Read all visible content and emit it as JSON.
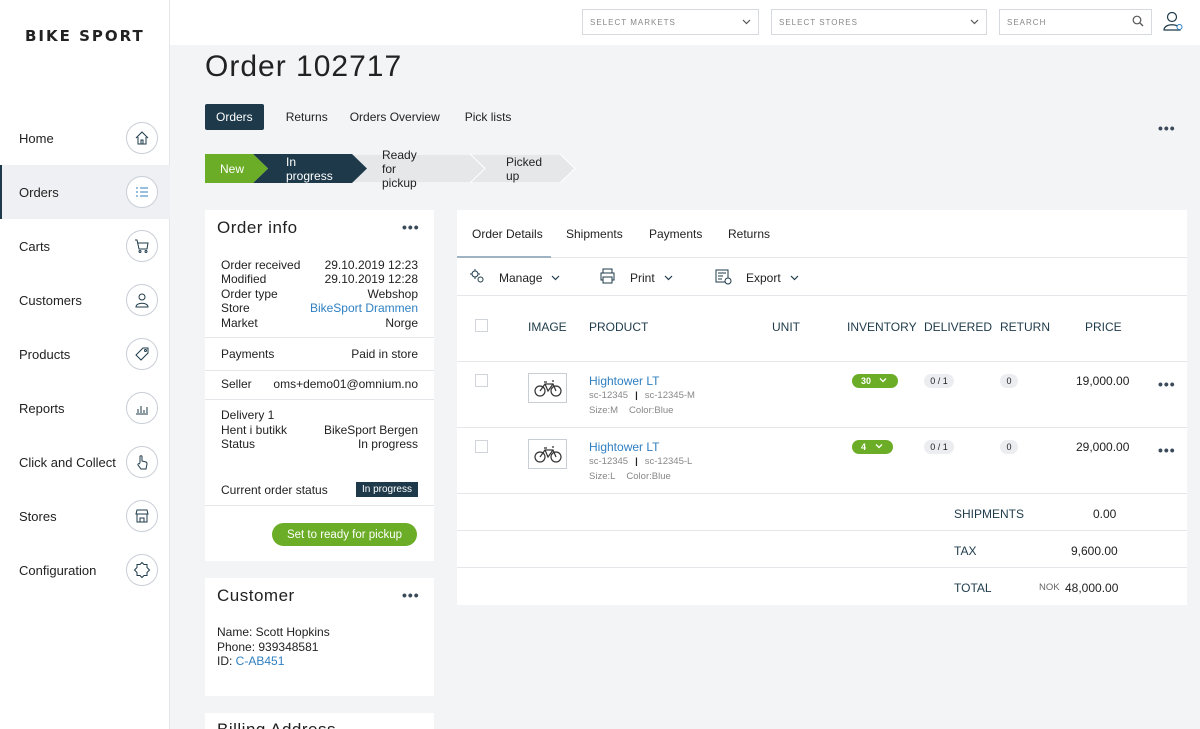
{
  "brand": "BIKE SPORT",
  "topbar": {
    "markets_placeholder": "SELECT MARKETS",
    "stores_placeholder": "SELECT STORES",
    "search_placeholder": "SEARCH"
  },
  "sidebar": {
    "items": [
      {
        "label": "Home",
        "icon": "home-icon"
      },
      {
        "label": "Orders",
        "icon": "list-icon"
      },
      {
        "label": "Carts",
        "icon": "cart-icon"
      },
      {
        "label": "Customers",
        "icon": "person-icon"
      },
      {
        "label": "Products",
        "icon": "tag-icon"
      },
      {
        "label": "Reports",
        "icon": "bar-chart-icon"
      },
      {
        "label": "Click and Collect",
        "icon": "hand-pointer-icon"
      },
      {
        "label": "Stores",
        "icon": "store-icon"
      },
      {
        "label": "Configuration",
        "icon": "gear-icon"
      }
    ]
  },
  "page_title": "Order 102717",
  "tabs": [
    "Orders",
    "Returns",
    "Orders Overview",
    "Pick lists"
  ],
  "steps": [
    "New",
    "In progress",
    "Ready for pickup",
    "Picked up"
  ],
  "order_info": {
    "title": "Order info",
    "received_label": "Order received",
    "received_value": "29.10.2019 12:23",
    "modified_label": "Modified",
    "modified_value": "29.10.2019 12:28",
    "type_label": "Order type",
    "type_value": "Webshop",
    "store_label": "Store",
    "store_value": "BikeSport Drammen",
    "market_label": "Market",
    "market_value": "Norge",
    "payments_label": "Payments",
    "payments_value": "Paid in store",
    "seller_label": "Seller",
    "seller_value": "oms+demo01@omnium.no",
    "delivery_label": "Delivery 1",
    "hent_label": "Hent i butikk",
    "hent_value": "BikeSport Bergen",
    "status_label": "Status",
    "status_value": "In progress",
    "current_status_label": "Current order status",
    "current_status_value": "In progress",
    "action_button": "Set to ready for pickup"
  },
  "customer": {
    "title": "Customer",
    "name_line": "Name: Scott Hopkins",
    "phone_line": "Phone: 939348581",
    "id_label": "ID: ",
    "id_value": "C-AB451"
  },
  "billing": {
    "title": "Billing Address"
  },
  "details": {
    "tabs": [
      "Order Details",
      "Shipments",
      "Payments",
      "Returns"
    ],
    "toolbar": {
      "manage": "Manage",
      "print": "Print",
      "export": "Export"
    },
    "columns": [
      "IMAGE",
      "PRODUCT",
      "UNIT",
      "INVENTORY",
      "DELIVERED",
      "RETURN",
      "PRICE"
    ],
    "lines": [
      {
        "name": "Hightower LT",
        "sku": "sc-12345",
        "variant": "sc-12345-M",
        "size": "Size:M",
        "color": "Color:Blue",
        "inventory": "30",
        "delivered": "0 / 1",
        "return": "0",
        "price": "19,000.00"
      },
      {
        "name": "Hightower LT",
        "sku": "sc-12345",
        "variant": "sc-12345-L",
        "size": "Size:L",
        "color": "Color:Blue",
        "inventory": "4",
        "delivered": "0 / 1",
        "return": "0",
        "price": "29,000.00"
      }
    ],
    "shipments_label": "SHIPMENTS",
    "shipments_value": "0.00",
    "tax_label": "TAX",
    "tax_value": "9,600.00",
    "total_label": "TOTAL",
    "total_currency": "NOK",
    "total_value": "48,000.00"
  },
  "colors": {
    "accent_dark": "#1e3a4a",
    "green": "#6bad26",
    "link": "#2f7fc1"
  }
}
